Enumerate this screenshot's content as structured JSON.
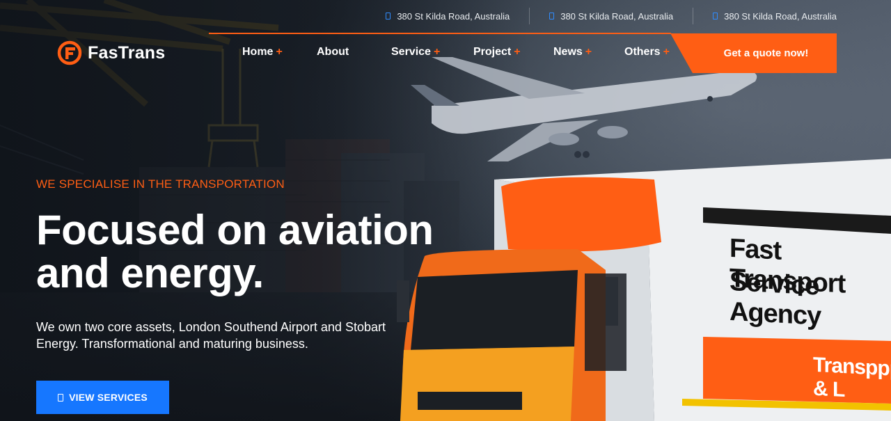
{
  "topbar": {
    "items": [
      {
        "icon": "location-icon",
        "text": "380 St Kilda Road, Australia"
      },
      {
        "icon": "location-icon",
        "text": "380 St Kilda Road, Australia"
      },
      {
        "icon": "location-icon",
        "text": "380 St Kilda Road, Australia"
      }
    ]
  },
  "brand": {
    "name": "FasTrans",
    "accent": "#ff5e14"
  },
  "nav": {
    "items": [
      {
        "label": "Home",
        "has_submenu": true
      },
      {
        "label": "About",
        "has_submenu": false
      },
      {
        "label": "Service",
        "has_submenu": true
      },
      {
        "label": "Project",
        "has_submenu": true
      },
      {
        "label": "News",
        "has_submenu": true
      },
      {
        "label": "Others",
        "has_submenu": true
      }
    ],
    "submenu_marker": "+",
    "cta_label": "Get a quote now!"
  },
  "hero": {
    "eyebrow": "WE SPECIALISE IN THE TRANSPORTATION",
    "headline_line1": "Focused on aviation",
    "headline_line2": "and energy.",
    "description_line1": "We own two core assets, London Southend Airport and Stobart",
    "description_line2": "Energy. Transformational and maturing business.",
    "button_label": "VIEW SERVICES",
    "button_color": "#1677ff"
  },
  "truck_graphic": {
    "line1": "Fast Transport",
    "line2": "Service Agency",
    "stripe_text": "Transppport & L"
  }
}
